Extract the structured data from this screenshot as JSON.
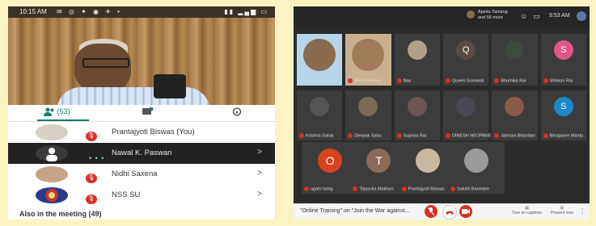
{
  "left": {
    "status": {
      "time": "10:15 AM",
      "icons": "✉ ◎ ✦ ◉ ✈ •",
      "right": "▮▮ ▂▄▆ ▭"
    },
    "tabs": {
      "people": "(53)",
      "chat_badge": "1"
    },
    "participants": [
      {
        "name": "Prantajyoti Biswas (You)",
        "badge": "🎙"
      },
      {
        "name": "Nawal K. Paswan",
        "badge": "",
        "chevron": ">"
      },
      {
        "name": "Nidhi Saxena",
        "badge": "🎙",
        "chevron": ">"
      },
      {
        "name": "NSS SU",
        "badge": "🎙",
        "chevron": ">"
      }
    ],
    "also": "Also in the meeting (49)"
  },
  "right": {
    "host_name": "Ajanta Tamang",
    "host_more": "and 56 more",
    "clock": "9:53 AM",
    "tiles": [
      {
        "label": "",
        "letter": "",
        "color": "#8a6b4d"
      },
      {
        "label": "Nidhi Saxena",
        "letter": "",
        "color": "#a07b5a"
      },
      {
        "label": "Nas",
        "letter": "",
        "color": "#b0a08a"
      },
      {
        "label": "Queen Sonowal",
        "letter": "Q",
        "color": "#5a4a44"
      },
      {
        "label": "Bhumika Rai",
        "letter": "",
        "color": "#3e4a3e"
      },
      {
        "label": "Shimon Rai",
        "letter": "S",
        "color": "#e0568a"
      },
      {
        "label": "Krishna Sahai",
        "letter": "",
        "color": "#555555"
      },
      {
        "label": "Deepak Sahu",
        "letter": "",
        "color": "#7a6b55"
      },
      {
        "label": "Supriya Rai",
        "letter": "",
        "color": "#6b5555"
      },
      {
        "label": "DINESH NEOPANEY",
        "letter": "",
        "color": "#4a4a55"
      },
      {
        "label": "Jahnavi Bhandari",
        "letter": "",
        "color": "#8a5a4a"
      },
      {
        "label": "Bhrajasee Mantu",
        "letter": "S",
        "color": "#1e88c8"
      },
      {
        "label": "ugam tamg",
        "letter": "O",
        "color": "#d8431f"
      },
      {
        "label": "Tejasvila Makhan",
        "letter": "T",
        "color": "#8a6b55"
      },
      {
        "label": "Prantajyoti Biswas",
        "letter": "",
        "color": "#c9b8a0"
      },
      {
        "label": "Sakshi Banerjee",
        "letter": "",
        "color": "#9a9a9a"
      }
    ],
    "meeting_title": "\"Online Training\" on \"Join the War against...",
    "captions": "Turn on captions",
    "present": "Present now",
    "more": "⋮"
  }
}
